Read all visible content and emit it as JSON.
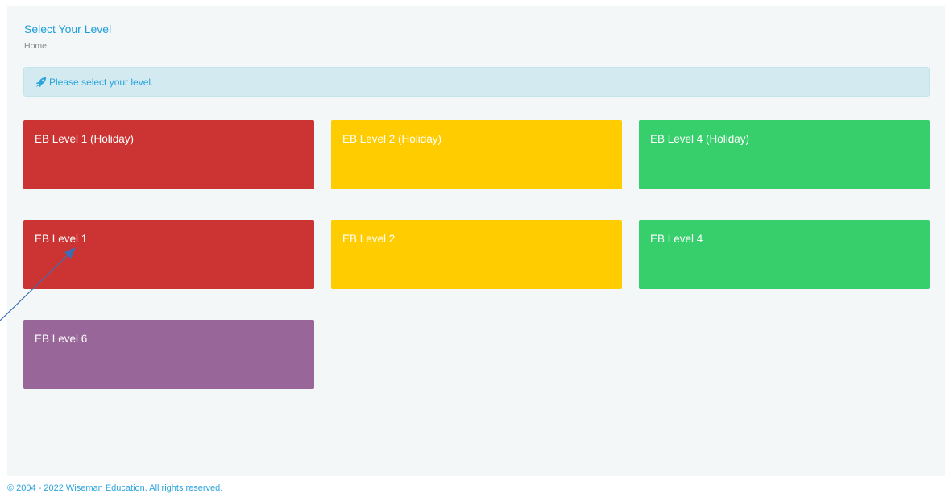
{
  "header": {
    "title": "Select Your Level",
    "breadcrumb": "Home"
  },
  "alert": {
    "icon": "rocket-icon",
    "text": "Please select your level."
  },
  "levels": [
    {
      "label": "EB Level 1 (Holiday)",
      "color": "#cc3333"
    },
    {
      "label": "EB Level 2 (Holiday)",
      "color": "#ffcc00"
    },
    {
      "label": "EB Level 4 (Holiday)",
      "color": "#36cf6c"
    },
    {
      "label": "EB Level 1",
      "color": "#cc3333"
    },
    {
      "label": "EB Level 2",
      "color": "#ffcc00"
    },
    {
      "label": "EB Level 4",
      "color": "#36cf6c"
    },
    {
      "label": "EB Level 6",
      "color": "#996699"
    }
  ],
  "footer": {
    "text": "© 2004 - 2022 Wiseman Education. All rights reserved."
  },
  "colors": {
    "accent": "#1e9fdc",
    "alert_bg": "#d3ebf0",
    "page_bg": "#f3f7f8"
  }
}
